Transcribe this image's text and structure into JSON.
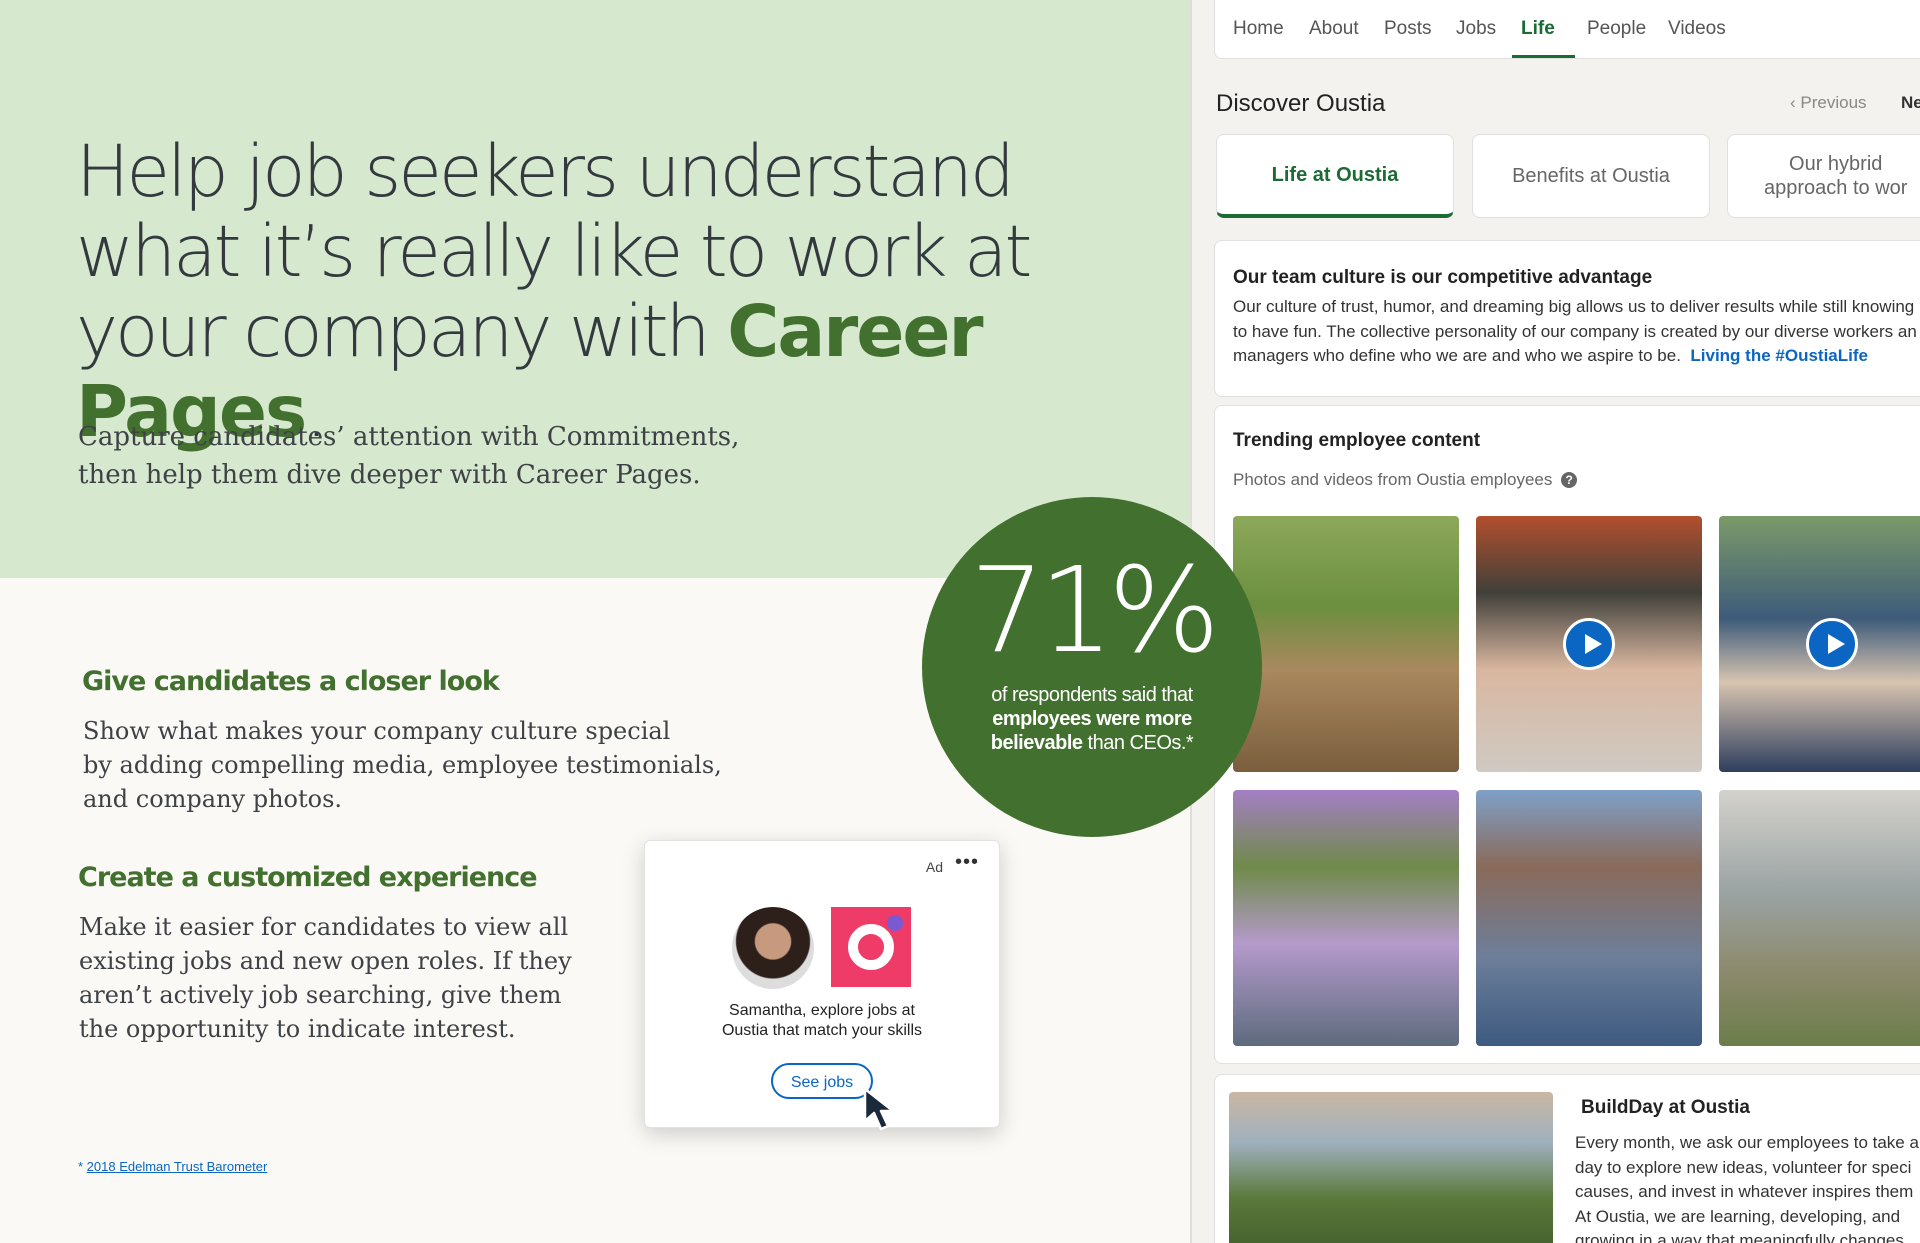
{
  "hero": {
    "headline_part1": "Help job seekers understand what it’s really like to work at your company with ",
    "headline_accent": "Career Pages",
    "headline_end": ".",
    "subhead_line1": "Capture candidates’ attention with Commitments,",
    "subhead_line2": "then help them dive deeper with Career Pages."
  },
  "features": [
    {
      "title": "Give candidates a closer look",
      "body": [
        "Show what makes your company culture special",
        "by adding compelling media, employee testimonials,",
        "and company photos."
      ]
    },
    {
      "title": "Create a customized experience",
      "body": [
        "Make it easier for candidates to view all",
        "existing jobs and new open roles. If they",
        "aren’t actively job searching, give them",
        "the opportunity to indicate interest."
      ]
    }
  ],
  "footnote": {
    "mark": "* ",
    "link": "2018 Edelman Trust Barometer"
  },
  "stat": {
    "value": "71%",
    "line1": "of respondents said that",
    "bold1": "employees were more",
    "bold2": "believable",
    "rest": " than CEOs.*"
  },
  "ad": {
    "label": "Ad",
    "more": "•••",
    "line1": "Samantha, explore jobs at",
    "line2": "Oustia that match your skills",
    "button": "See jobs",
    "icons": [
      "avatar",
      "oustia-logo",
      "cursor-icon"
    ]
  },
  "page_nav": {
    "tabs": [
      "Home",
      "About",
      "Posts",
      "Jobs",
      "Life",
      "People",
      "Videos"
    ],
    "active": "Life"
  },
  "discover": {
    "title": "Discover Oustia",
    "prev": "Previous",
    "next": "Ne",
    "categories": [
      "Life at Oustia",
      "Benefits at Oustia",
      "Our hybrid",
      "approach to wor"
    ]
  },
  "culture": {
    "title": "Our team culture is our competitive advantage",
    "lines": [
      "Our culture of trust, humor, and dreaming big allows us to deliver results while still knowing",
      "to have fun. The collective personality of our company is created by our diverse workers an",
      "managers who define who we are and who we aspire to be."
    ],
    "link": "Living the #OustiaLife"
  },
  "trending": {
    "title": "Trending employee content",
    "subtitle": "Photos and videos from Oustia employees",
    "help": "?"
  },
  "buildday": {
    "title": "BuildDay at Oustia",
    "lines": [
      "Every month, we ask our employees to take a",
      "day to explore new ideas, volunteer for speci",
      "causes, and invest in whatever inspires them",
      "At Oustia, we are learning, developing, and",
      "growing in a way that meaningfully changes"
    ]
  },
  "colors": {
    "brand_green": "#42702e",
    "page_green": "#1c6b35",
    "link_blue": "#0a66c2",
    "hero_bg": "#d6e8ce",
    "ad_logo": "#ee3b67"
  }
}
